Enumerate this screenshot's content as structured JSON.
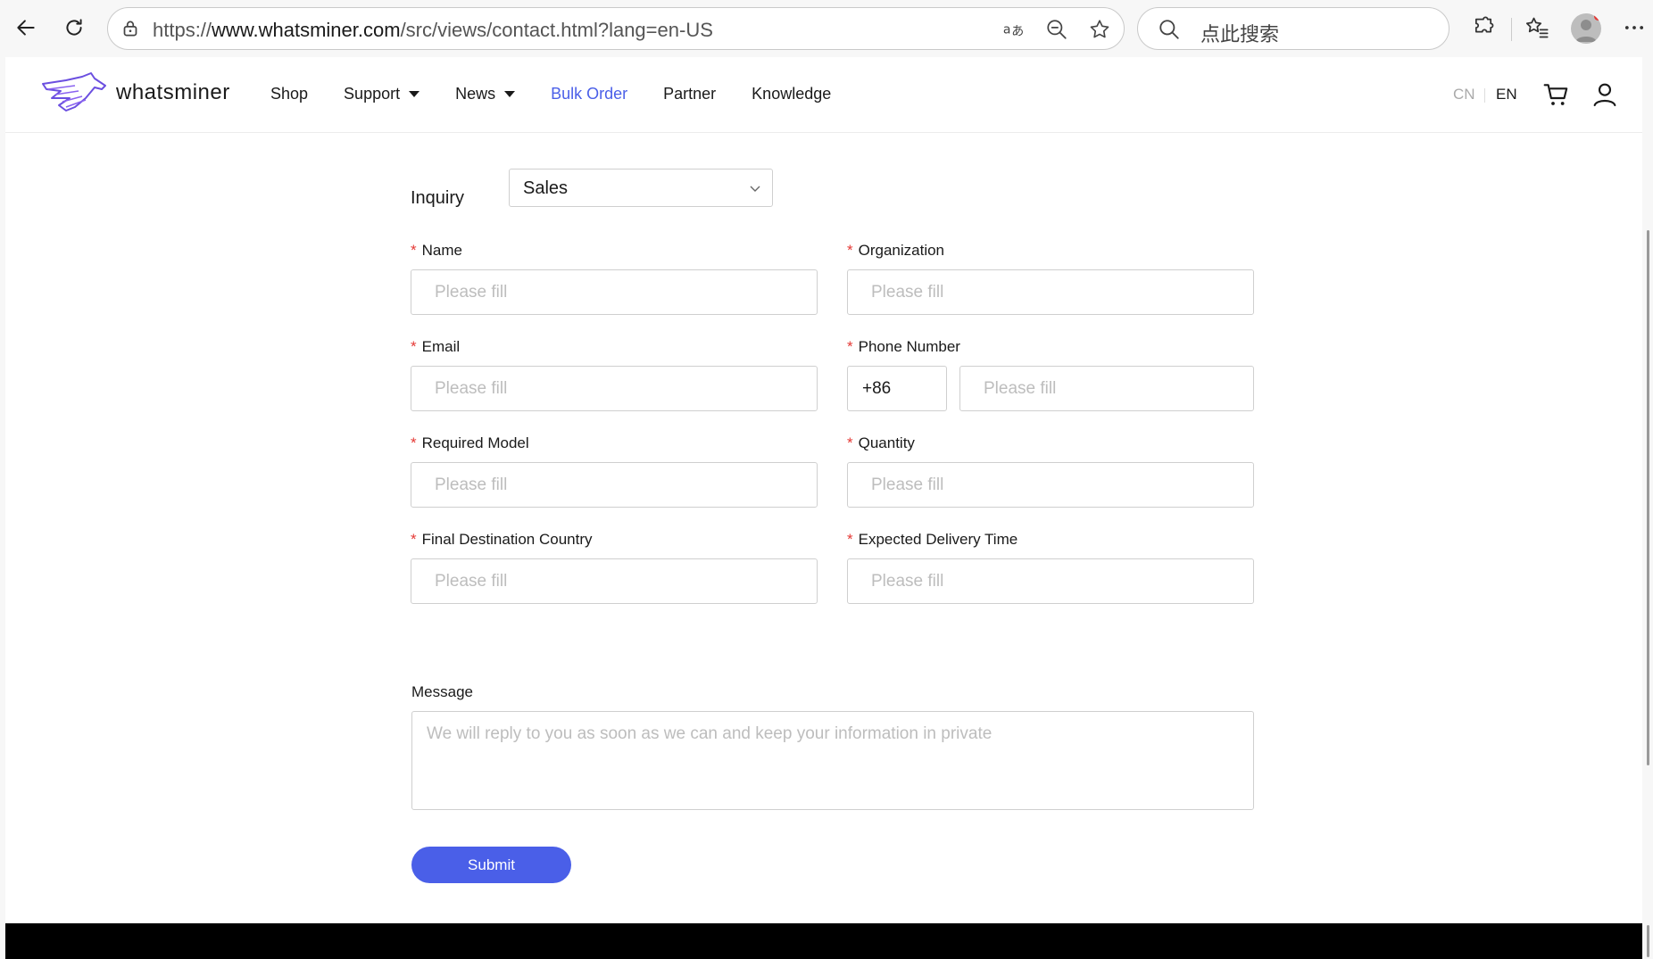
{
  "browser": {
    "url_prefix": "https://",
    "url_domain": "www.whatsminer.com",
    "url_path": "/src/views/contact.html?lang=en-US",
    "search_text": "点此搜索"
  },
  "header": {
    "brand": "whatsminer",
    "menu": [
      {
        "label": "Shop"
      },
      {
        "label": "Support"
      },
      {
        "label": "News"
      },
      {
        "label": "Bulk Order"
      },
      {
        "label": "Partner"
      },
      {
        "label": "Knowledge"
      }
    ],
    "lang_cn": "CN",
    "lang_en": "EN"
  },
  "form": {
    "inquiry_label": "Inquiry",
    "inquiry_value": "Sales",
    "required_mark": "*",
    "placeholder": "Please fill",
    "fields": {
      "name": "Name",
      "organization": "Organization",
      "email": "Email",
      "phone": "Phone Number",
      "model": "Required Model",
      "quantity": "Quantity",
      "country": "Final Destination Country",
      "delivery": "Expected Delivery Time"
    },
    "phone_code": "+86",
    "message_label": "Message",
    "message_placeholder": "We will reply to you as soon as we can and keep your information in private",
    "submit_label": "Submit"
  },
  "colors": {
    "accent": "#4a5fe8",
    "required": "#e53935"
  }
}
